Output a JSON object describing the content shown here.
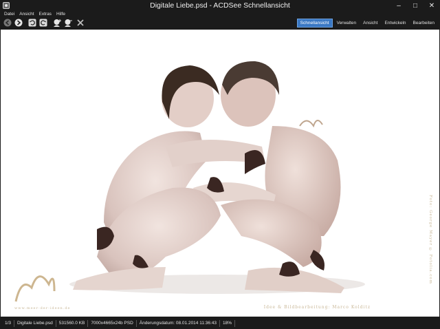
{
  "window": {
    "title": "Digitale Liebe.psd - ACDSee Schnellansicht",
    "minimize": "–",
    "maximize": "□",
    "close": "✕"
  },
  "menu": [
    "Datei",
    "Ansicht",
    "Extras",
    "Hilfe"
  ],
  "toolbar": {
    "icons": [
      "back-icon",
      "forward-icon",
      "rotate-left-icon",
      "rotate-right-icon",
      "zoom-in-icon",
      "zoom-out-icon",
      "close-image-icon"
    ],
    "modes": [
      "Schnellansicht",
      "Verwalten",
      "Ansicht",
      "Entwickeln",
      "Bearbeiten"
    ],
    "active_mode": "Schnellansicht"
  },
  "image": {
    "credit_right": "Idee & Bildbearbeitung: Marco Kolditz",
    "credit_foto": "Foto: George Mayer © Fotolia.com",
    "credit_site": "www.meer-der-ideen.de"
  },
  "statusbar": {
    "position": "1/3",
    "filename": "Digitale Liebe.psd",
    "filesize": "531560.0 KB",
    "dimensions": "7000x4665x24b PSD",
    "modified": "Änderungsdatum: 08.01.2014 11:36:43",
    "zoom": "18%"
  },
  "colors": {
    "accent": "#3a78c4",
    "chrome": "#1b1b1b",
    "canvas": "#ffffff"
  }
}
